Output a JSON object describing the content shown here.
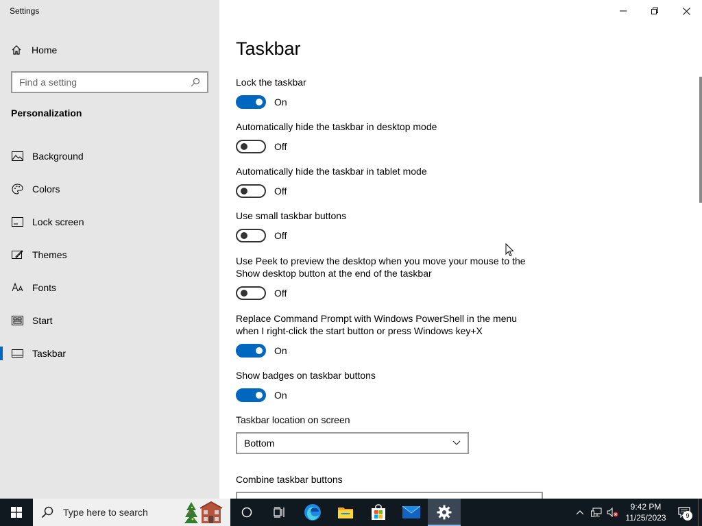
{
  "window": {
    "app_title": "Settings"
  },
  "sidebar": {
    "home_label": "Home",
    "search_placeholder": "Find a setting",
    "section_title": "Personalization",
    "items": [
      {
        "label": "Background",
        "icon": "background-icon"
      },
      {
        "label": "Colors",
        "icon": "palette-icon"
      },
      {
        "label": "Lock screen",
        "icon": "lock-screen-icon"
      },
      {
        "label": "Themes",
        "icon": "themes-icon"
      },
      {
        "label": "Fonts",
        "icon": "fonts-icon"
      },
      {
        "label": "Start",
        "icon": "start-icon"
      },
      {
        "label": "Taskbar",
        "icon": "taskbar-icon",
        "active": true
      }
    ]
  },
  "main": {
    "title": "Taskbar",
    "settings": [
      {
        "label": "Lock the taskbar",
        "state": "On"
      },
      {
        "label": "Automatically hide the taskbar in desktop mode",
        "state": "Off"
      },
      {
        "label": "Automatically hide the taskbar in tablet mode",
        "state": "Off"
      },
      {
        "label": "Use small taskbar buttons",
        "state": "Off"
      },
      {
        "label": "Use Peek to preview the desktop when you move your mouse to the Show desktop button at the end of the taskbar",
        "state": "Off"
      },
      {
        "label": "Replace Command Prompt with Windows PowerShell in the menu when I right-click the start button or press Windows key+X",
        "state": "On"
      },
      {
        "label": "Show badges on taskbar buttons",
        "state": "On"
      }
    ],
    "location_label": "Taskbar location on screen",
    "location_value": "Bottom",
    "combine_label": "Combine taskbar buttons",
    "combine_value": ""
  },
  "taskbar": {
    "search_placeholder": "Type here to search",
    "time": "9:42 PM",
    "date": "11/25/2023",
    "notification_count": "9"
  },
  "colors": {
    "accent": "#0067c0",
    "sidebar_bg": "#e6e6e6",
    "taskbar_bg": "#101820"
  }
}
